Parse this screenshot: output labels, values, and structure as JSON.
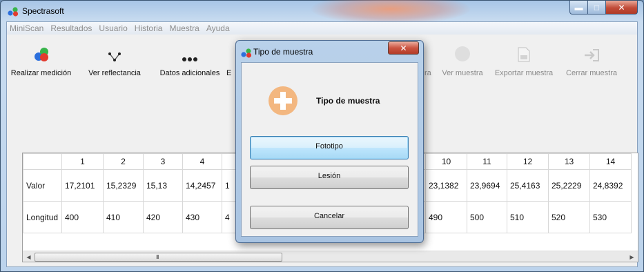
{
  "app": {
    "title": "Spectrasoft"
  },
  "menu": [
    "MiniScan",
    "Resultados",
    "Usuario",
    "Historia",
    "Muestra",
    "Ayuda"
  ],
  "toolbar": {
    "realizar": "Realizar medición",
    "reflectancia": "Ver reflectancia",
    "datos": "Datos adicionales",
    "partial_b": "E",
    "partial_ra": "ra",
    "ver_muestra": "Ver muestra",
    "exportar": "Exportar muestra",
    "cerrar": "Cerrar muestra"
  },
  "table": {
    "columns": [
      "",
      "1",
      "2",
      "3",
      "4",
      "",
      "",
      "",
      "",
      "",
      "10",
      "11",
      "12",
      "13",
      "14"
    ],
    "rows": [
      {
        "label": "Valor",
        "cells": [
          "17,2101",
          "15,2329",
          "15,13",
          "14,2457",
          "1",
          "",
          "",
          "",
          "",
          "23,1382",
          "23,9694",
          "25,4163",
          "25,2229",
          "24,8392"
        ]
      },
      {
        "label": "Longitud",
        "cells": [
          "400",
          "410",
          "420",
          "430",
          "4",
          "",
          "",
          "",
          "",
          "490",
          "500",
          "510",
          "520",
          "530"
        ]
      }
    ]
  },
  "scrollbar": {
    "grip": "III"
  },
  "dialog": {
    "title": "Tipo de muestra",
    "heading": "Tipo de muestra",
    "buttons": {
      "fototipo": "Fototipo",
      "lesion": "Lesión",
      "cancelar": "Cancelar"
    }
  },
  "colors": {
    "accent": "#3c7fb1",
    "plus": "#f3b780",
    "close": "#c14b38"
  }
}
